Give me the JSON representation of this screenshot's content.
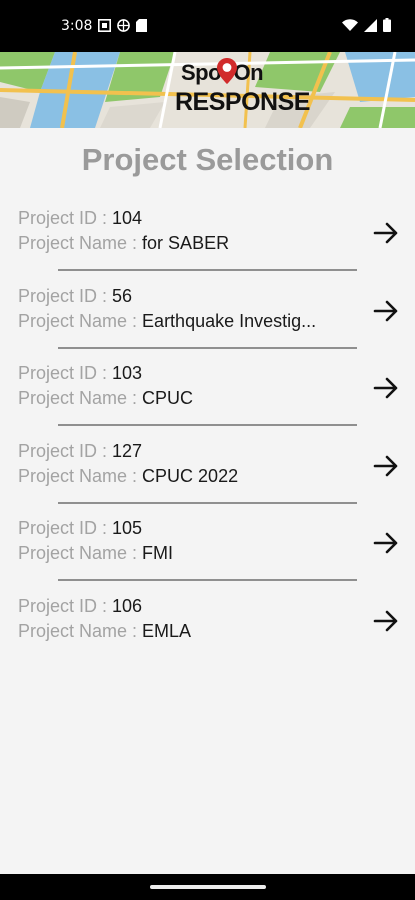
{
  "status_bar": {
    "time": "3:08",
    "left_icons": [
      "notification-box-icon",
      "vpn-globe-icon",
      "sd-card-icon"
    ],
    "right_icons": [
      "wifi-icon",
      "signal-icon",
      "battery-icon"
    ]
  },
  "header": {
    "logo_top": "Spot On",
    "logo_bottom": "RESPONSE"
  },
  "page": {
    "title": "Project Selection"
  },
  "projects": [
    {
      "id_label": "Project ID : ",
      "id": "104",
      "name_label": "Project Name : ",
      "name": "for SABER"
    },
    {
      "id_label": "Project ID : ",
      "id": "56",
      "name_label": "Project Name : ",
      "name": "Earthquake Investig..."
    },
    {
      "id_label": "Project ID : ",
      "id": "103",
      "name_label": "Project Name : ",
      "name": "CPUC"
    },
    {
      "id_label": "Project ID : ",
      "id": "127",
      "name_label": "Project Name : ",
      "name": "CPUC 2022"
    },
    {
      "id_label": "Project ID : ",
      "id": "105",
      "name_label": "Project Name : ",
      "name": "FMI"
    },
    {
      "id_label": "Project ID : ",
      "id": "106",
      "name_label": "Project Name : ",
      "name": "EMLA"
    }
  ],
  "colors": {
    "title": "#9a9a9a",
    "label": "#a3a3a3",
    "value": "#1a1a1a",
    "divider": "#8f8f8f",
    "logo_pin": "#d12b2b"
  }
}
